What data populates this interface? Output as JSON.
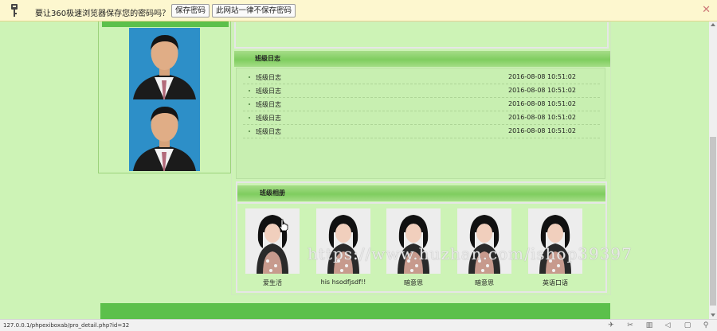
{
  "password_bar": {
    "message": "要让360极速浏览器保存您的密码吗？",
    "save_button": "保存密码",
    "never_button": "此网站一律不保存密码",
    "close_icon": "close-icon",
    "key_icon": "key-icon"
  },
  "log_section": {
    "title": "班级日志",
    "items": [
      {
        "title": "班级日志",
        "time": "2016-08-08 10:51:02"
      },
      {
        "title": "班级日志",
        "time": "2016-08-08 10:51:02"
      },
      {
        "title": "班级日志",
        "time": "2016-08-08 10:51:02"
      },
      {
        "title": "班级日志",
        "time": "2016-08-08 10:51:02"
      },
      {
        "title": "班级日志",
        "time": "2016-08-08 10:51:02"
      }
    ]
  },
  "album_section": {
    "title": "班级相册",
    "photos": [
      {
        "caption": "爱生活"
      },
      {
        "caption": "his hsodfjsdf!!"
      },
      {
        "caption": "暗意思"
      },
      {
        "caption": "暗意思"
      },
      {
        "caption": "英语口语"
      }
    ]
  },
  "watermark": "https://www.huzhan.com/ishop39397",
  "status_bar": {
    "url": "127.0.0.1/phpexiboxab/pro_detail.php?id=32"
  },
  "colors": {
    "page_bg": "#cdf3b6",
    "accent_green": "#5cc04b",
    "password_bar_bg": "#fdf7cf"
  }
}
